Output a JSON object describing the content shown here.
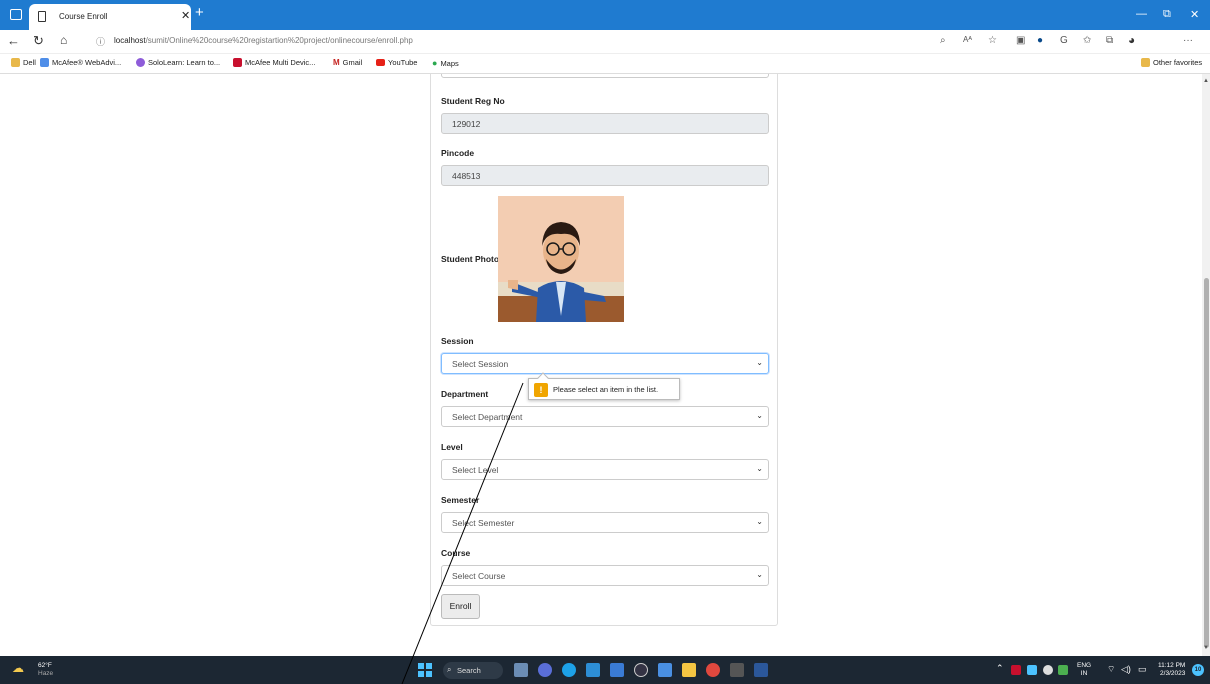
{
  "browser": {
    "tab_title": "Course Enroll",
    "url_host": "localhost",
    "url_path": "/sumit/Online%20course%20registartion%20project/onlinecourse/enroll.php",
    "favorites": [
      "Dell",
      "McAfee® WebAdvi...",
      "SoloLearn: Learn to...",
      "McAfee Multi Devic...",
      "Gmail",
      "YouTube",
      "Maps"
    ],
    "other_favorites": "Other favorites"
  },
  "form": {
    "reg_no_label": "Student Reg No",
    "reg_no_value": "129012",
    "pincode_label": "Pincode",
    "pincode_value": "448513",
    "photo_label": "Student Photo",
    "session_label": "Session",
    "session_placeholder": "Select Session",
    "department_label": "Department",
    "department_placeholder": "Select Department",
    "level_label": "Level",
    "level_placeholder": "Select Level",
    "semester_label": "Semester",
    "semester_placeholder": "Select Semester",
    "course_label": "Course",
    "course_placeholder": "Select Course",
    "enroll_label": "Enroll",
    "validation_message": "Please select an item in the list."
  },
  "taskbar": {
    "weather_temp": "62°F",
    "weather_desc": "Haze",
    "search_label": "Search",
    "lang_top": "ENG",
    "lang_bottom": "IN",
    "time": "11:12 PM",
    "date": "2/3/2023",
    "notifications": "10"
  }
}
